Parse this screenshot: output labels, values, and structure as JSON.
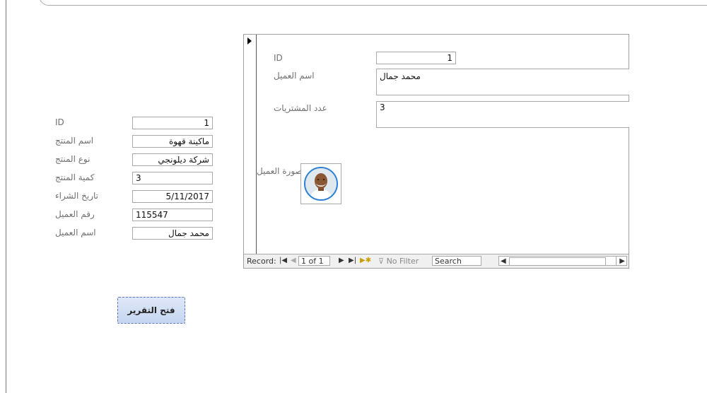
{
  "main_form": {
    "fields": [
      {
        "label": "ID",
        "value": "1"
      },
      {
        "label": "اسم المنتج",
        "value": "ماكينة قهوة"
      },
      {
        "label": "نوع المنتج",
        "value": "شركة ديلونجي"
      },
      {
        "label": "كمية المنتج",
        "value": "3"
      },
      {
        "label": "تاريخ الشراء",
        "value": "5/11/2017"
      },
      {
        "label": "رقم العميل",
        "value": "115547"
      },
      {
        "label": "اسم العميل",
        "value": "محمد جمال"
      }
    ],
    "open_report_button": "فتح التقرير"
  },
  "subform": {
    "id_label": "ID",
    "id_value": "1",
    "customer_name_label": "اسم العميل",
    "customer_name_value": "محمد جمال",
    "purchases_label": "عدد المشتريات",
    "purchases_value": "3",
    "photo_label": "صورة العميل",
    "navigation": {
      "record_label": "Record:",
      "record_position": "1 of 1",
      "filter_label": "No Filter",
      "search_placeholder": "Search"
    }
  },
  "icons": {
    "first_record": "first-record-icon",
    "prev_record": "previous-record-icon",
    "next_record": "next-record-icon",
    "last_record": "last-record-icon",
    "new_record": "new-record-icon",
    "filter": "filter-icon",
    "selector": "record-selector-arrow-icon"
  },
  "colors": {
    "button_fill": "#c5d5f0",
    "button_border": "#5a7ab0",
    "avatar_ring": "#2b7fd6"
  }
}
